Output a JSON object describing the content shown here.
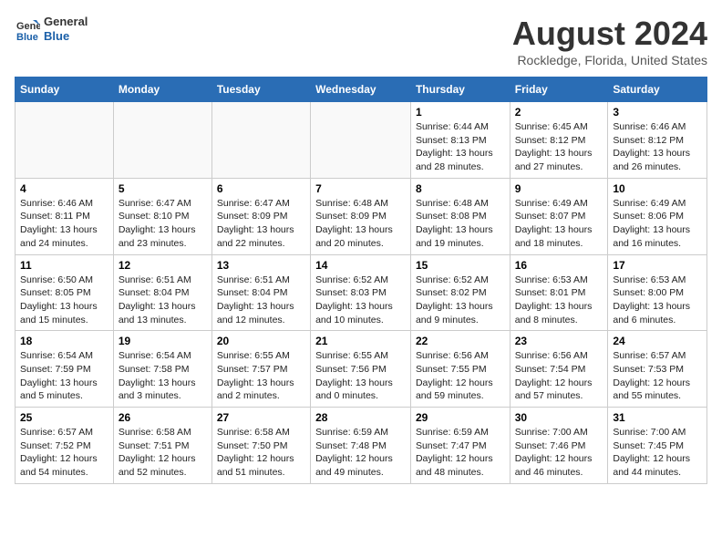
{
  "logo": {
    "line1": "General",
    "line2": "Blue"
  },
  "header": {
    "title": "August 2024",
    "subtitle": "Rockledge, Florida, United States"
  },
  "days_of_week": [
    "Sunday",
    "Monday",
    "Tuesday",
    "Wednesday",
    "Thursday",
    "Friday",
    "Saturday"
  ],
  "weeks": [
    [
      {
        "day": "",
        "sunrise": "",
        "sunset": "",
        "daylight": "",
        "empty": true
      },
      {
        "day": "",
        "sunrise": "",
        "sunset": "",
        "daylight": "",
        "empty": true
      },
      {
        "day": "",
        "sunrise": "",
        "sunset": "",
        "daylight": "",
        "empty": true
      },
      {
        "day": "",
        "sunrise": "",
        "sunset": "",
        "daylight": "",
        "empty": true
      },
      {
        "day": "1",
        "sunrise": "6:44 AM",
        "sunset": "8:13 PM",
        "daylight": "13 hours and 28 minutes."
      },
      {
        "day": "2",
        "sunrise": "6:45 AM",
        "sunset": "8:12 PM",
        "daylight": "13 hours and 27 minutes."
      },
      {
        "day": "3",
        "sunrise": "6:46 AM",
        "sunset": "8:12 PM",
        "daylight": "13 hours and 26 minutes."
      }
    ],
    [
      {
        "day": "4",
        "sunrise": "6:46 AM",
        "sunset": "8:11 PM",
        "daylight": "13 hours and 24 minutes."
      },
      {
        "day": "5",
        "sunrise": "6:47 AM",
        "sunset": "8:10 PM",
        "daylight": "13 hours and 23 minutes."
      },
      {
        "day": "6",
        "sunrise": "6:47 AM",
        "sunset": "8:09 PM",
        "daylight": "13 hours and 22 minutes."
      },
      {
        "day": "7",
        "sunrise": "6:48 AM",
        "sunset": "8:09 PM",
        "daylight": "13 hours and 20 minutes."
      },
      {
        "day": "8",
        "sunrise": "6:48 AM",
        "sunset": "8:08 PM",
        "daylight": "13 hours and 19 minutes."
      },
      {
        "day": "9",
        "sunrise": "6:49 AM",
        "sunset": "8:07 PM",
        "daylight": "13 hours and 18 minutes."
      },
      {
        "day": "10",
        "sunrise": "6:49 AM",
        "sunset": "8:06 PM",
        "daylight": "13 hours and 16 minutes."
      }
    ],
    [
      {
        "day": "11",
        "sunrise": "6:50 AM",
        "sunset": "8:05 PM",
        "daylight": "13 hours and 15 minutes."
      },
      {
        "day": "12",
        "sunrise": "6:51 AM",
        "sunset": "8:04 PM",
        "daylight": "13 hours and 13 minutes."
      },
      {
        "day": "13",
        "sunrise": "6:51 AM",
        "sunset": "8:04 PM",
        "daylight": "13 hours and 12 minutes."
      },
      {
        "day": "14",
        "sunrise": "6:52 AM",
        "sunset": "8:03 PM",
        "daylight": "13 hours and 10 minutes."
      },
      {
        "day": "15",
        "sunrise": "6:52 AM",
        "sunset": "8:02 PM",
        "daylight": "13 hours and 9 minutes."
      },
      {
        "day": "16",
        "sunrise": "6:53 AM",
        "sunset": "8:01 PM",
        "daylight": "13 hours and 8 minutes."
      },
      {
        "day": "17",
        "sunrise": "6:53 AM",
        "sunset": "8:00 PM",
        "daylight": "13 hours and 6 minutes."
      }
    ],
    [
      {
        "day": "18",
        "sunrise": "6:54 AM",
        "sunset": "7:59 PM",
        "daylight": "13 hours and 5 minutes."
      },
      {
        "day": "19",
        "sunrise": "6:54 AM",
        "sunset": "7:58 PM",
        "daylight": "13 hours and 3 minutes."
      },
      {
        "day": "20",
        "sunrise": "6:55 AM",
        "sunset": "7:57 PM",
        "daylight": "13 hours and 2 minutes."
      },
      {
        "day": "21",
        "sunrise": "6:55 AM",
        "sunset": "7:56 PM",
        "daylight": "13 hours and 0 minutes."
      },
      {
        "day": "22",
        "sunrise": "6:56 AM",
        "sunset": "7:55 PM",
        "daylight": "12 hours and 59 minutes."
      },
      {
        "day": "23",
        "sunrise": "6:56 AM",
        "sunset": "7:54 PM",
        "daylight": "12 hours and 57 minutes."
      },
      {
        "day": "24",
        "sunrise": "6:57 AM",
        "sunset": "7:53 PM",
        "daylight": "12 hours and 55 minutes."
      }
    ],
    [
      {
        "day": "25",
        "sunrise": "6:57 AM",
        "sunset": "7:52 PM",
        "daylight": "12 hours and 54 minutes."
      },
      {
        "day": "26",
        "sunrise": "6:58 AM",
        "sunset": "7:51 PM",
        "daylight": "12 hours and 52 minutes."
      },
      {
        "day": "27",
        "sunrise": "6:58 AM",
        "sunset": "7:50 PM",
        "daylight": "12 hours and 51 minutes."
      },
      {
        "day": "28",
        "sunrise": "6:59 AM",
        "sunset": "7:48 PM",
        "daylight": "12 hours and 49 minutes."
      },
      {
        "day": "29",
        "sunrise": "6:59 AM",
        "sunset": "7:47 PM",
        "daylight": "12 hours and 48 minutes."
      },
      {
        "day": "30",
        "sunrise": "7:00 AM",
        "sunset": "7:46 PM",
        "daylight": "12 hours and 46 minutes."
      },
      {
        "day": "31",
        "sunrise": "7:00 AM",
        "sunset": "7:45 PM",
        "daylight": "12 hours and 44 minutes."
      }
    ]
  ]
}
